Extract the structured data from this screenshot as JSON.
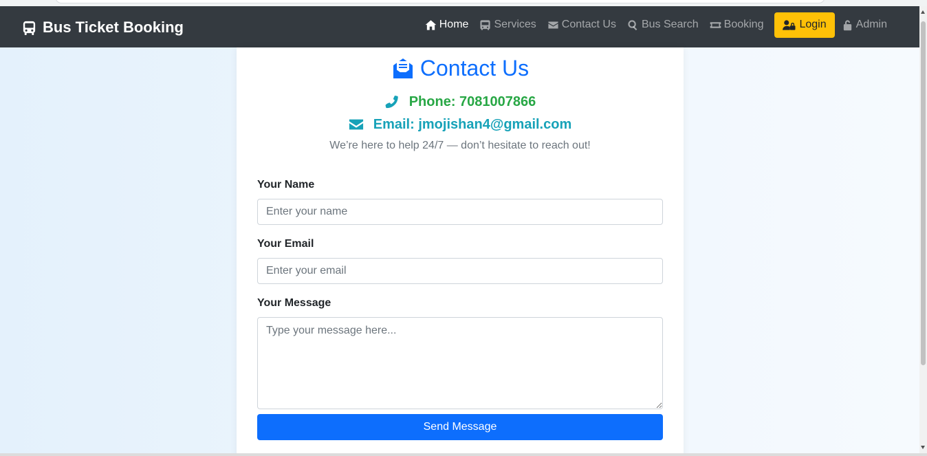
{
  "brand": {
    "title": "Bus Ticket Booking",
    "icon": "bus-icon"
  },
  "nav": {
    "items": [
      {
        "label": "Home",
        "icon": "home-icon",
        "active": true
      },
      {
        "label": "Services",
        "icon": "bus-small-icon"
      },
      {
        "label": "Contact Us",
        "icon": "envelope-icon"
      },
      {
        "label": "Bus Search",
        "icon": "search-icon"
      },
      {
        "label": "Booking",
        "icon": "ticket-icon"
      }
    ],
    "login_label": "Login",
    "admin_label": "Admin"
  },
  "contact": {
    "title": "Contact Us",
    "phone_label": "Phone:",
    "phone_value": "7081007866",
    "email_label": "Email:",
    "email_value": "jmojishan4@gmail.com",
    "help_text": "We’re here to help 24/7 — don’t hesitate to reach out!"
  },
  "form": {
    "name_label": "Your Name",
    "name_placeholder": "Enter your name",
    "email_label": "Your Email",
    "email_placeholder": "Enter your email",
    "message_label": "Your Message",
    "message_placeholder": "Type your message here...",
    "submit_label": "Send Message"
  },
  "colors": {
    "navbar": "#343a40",
    "primary": "#0d6efd",
    "warning": "#ffc107",
    "success": "#28a745",
    "info": "#17a2b8"
  }
}
